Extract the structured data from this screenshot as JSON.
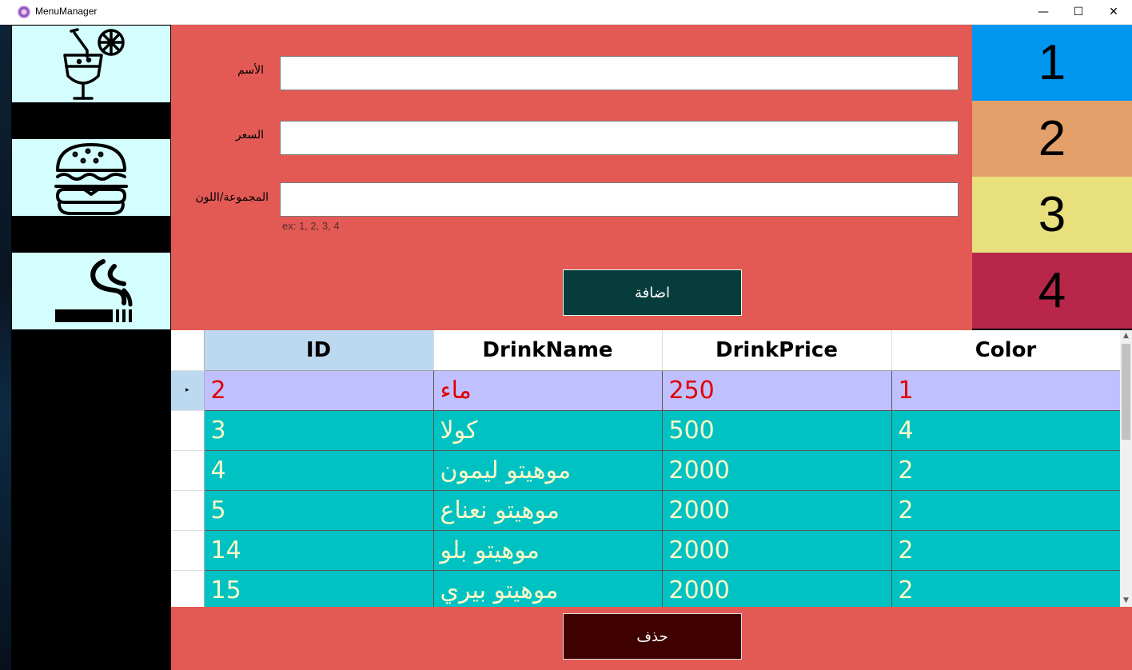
{
  "window": {
    "title": "MenuManager",
    "minimize": "—",
    "maximize": "☐",
    "close": "✕"
  },
  "sidebar": {
    "items": [
      {
        "name": "drinks",
        "icon": "cocktail-icon"
      },
      {
        "name": "food",
        "icon": "burger-icon"
      },
      {
        "name": "smoking",
        "icon": "cigarette-icon"
      }
    ]
  },
  "form": {
    "name_label": "الأسم",
    "name_value": "",
    "price_label": "السعر",
    "price_value": "",
    "group_label": "المجموعة/اللون",
    "group_value": "",
    "group_hint": "ex: 1, 2, 3, 4",
    "add_button": "اضافة"
  },
  "groups": [
    {
      "label": "1",
      "color": "#0096f0"
    },
    {
      "label": "2",
      "color": "#e3a06a"
    },
    {
      "label": "3",
      "color": "#e8e07c"
    },
    {
      "label": "4",
      "color": "#b8264a"
    }
  ],
  "grid": {
    "columns": [
      "ID",
      "DrinkName",
      "DrinkPrice",
      "Color"
    ],
    "current_row_marker": "▸",
    "rows": [
      [
        "2",
        "ماء",
        "250",
        "1"
      ],
      [
        "3",
        "كولا",
        "500",
        "4"
      ],
      [
        "4",
        "موهيتو ليمون",
        "2000",
        "2"
      ],
      [
        "5",
        "موهيتو نعناع",
        "2000",
        "2"
      ],
      [
        "14",
        "موهيتو بلو",
        "2000",
        "2"
      ],
      [
        "15",
        "موهيتو بيري",
        "2000",
        "2"
      ]
    ]
  },
  "scrollbar": {
    "up": "▲",
    "down": "▼"
  },
  "delete_button": "حذف"
}
